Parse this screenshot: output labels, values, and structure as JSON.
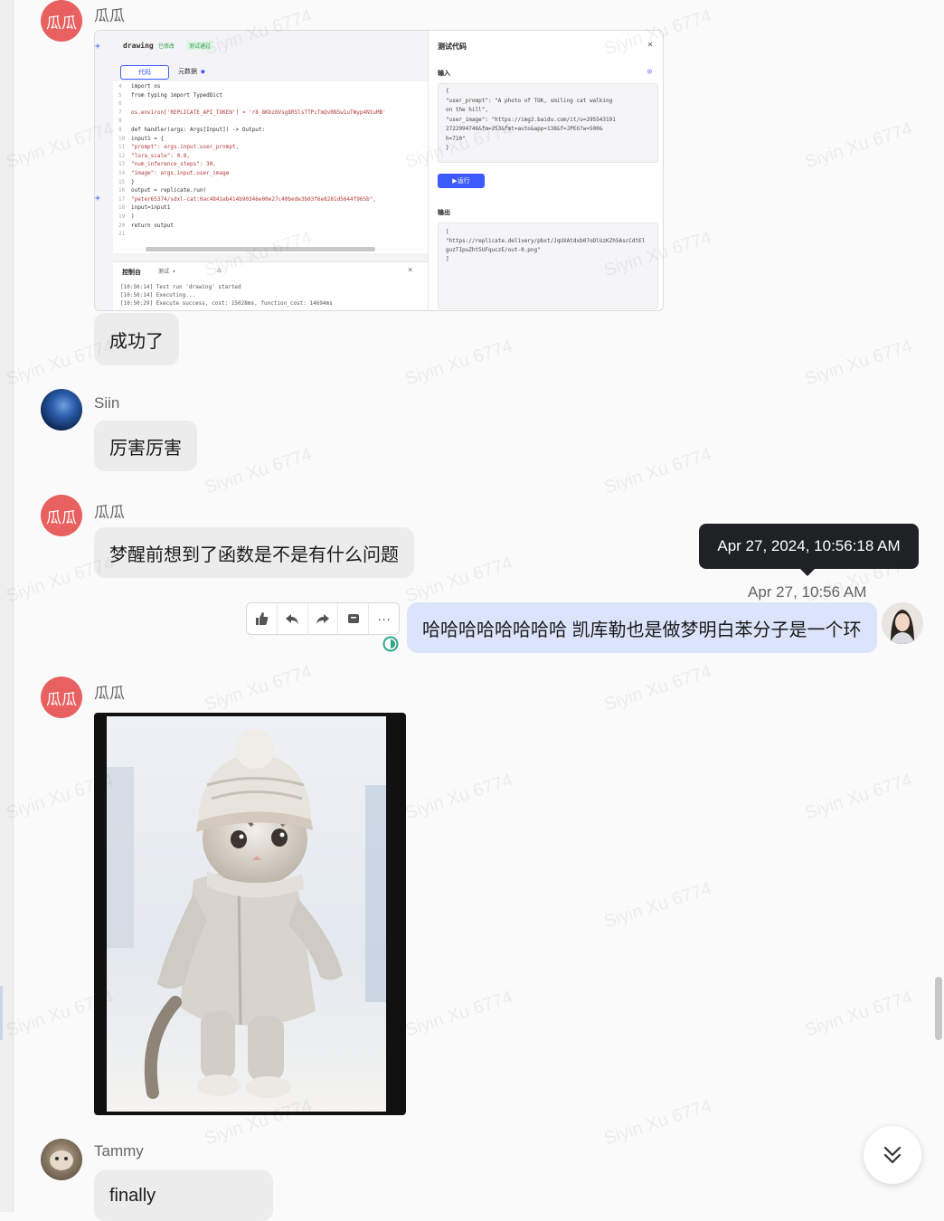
{
  "messages": {
    "m1": {
      "sender": "瓜瓜",
      "avatar_text": "瓜瓜",
      "text": "成功了"
    },
    "m2": {
      "sender": "Siin",
      "text": "厉害厉害"
    },
    "m3": {
      "sender": "瓜瓜",
      "avatar_text": "瓜瓜",
      "text": "梦醒前想到了函数是不是有什么问题"
    },
    "m4": {
      "time": "Apr 27, 10:56 AM",
      "tooltip": "Apr 27, 2024, 10:56:18 AM",
      "text": "哈哈哈哈哈哈哈哈 凯库勒也是做梦明白苯分子是一个环"
    },
    "m5": {
      "sender": "瓜瓜",
      "avatar_text": "瓜瓜"
    },
    "m6": {
      "sender": "Tammy",
      "text": "finally"
    }
  },
  "toolbar": {
    "icons": [
      "thumbs-up-icon",
      "reply-icon",
      "forward-icon",
      "save-icon",
      "more-icon"
    ],
    "more_label": "···"
  },
  "embedded_screenshot": {
    "app_name": "drawing",
    "status": "已修改",
    "badge": "测试通过",
    "tab_code": "代码",
    "tab_meta": "元数据",
    "console_title": "控制台",
    "console_select": "测试",
    "panel_title": "测试代码",
    "input_label": "输入",
    "run_button": "运行",
    "output_label": "输出",
    "code": [
      "import os",
      "from typing import TypedDict",
      "",
      "os.environ['REPLICATE_API_TOKEN'] = 'r8_8Kbz6Vsg8R5lsTTPcTmQvRN5w1uTWyp4NtuMB'",
      "",
      "def handler(args: Args[Input]) -> Output:",
      "    input1 = {",
      "        \"prompt\": args.input.user_prompt,",
      "        \"lora_scale\": 0.8,",
      "        \"num_inference_steps\": 30,",
      "        \"image\": args.input.user_image",
      "    }",
      "    output = replicate.run(",
      "        \"peter65374/sdxl-cat:0ac4841eb414b90346e00e27c40bede3b03f6e8281d5644f965b\",",
      "        input=input1",
      "    )",
      "    return output",
      ""
    ],
    "console_lines": [
      "[10:50:14] Test run 'drawing' started",
      "[10:50:14] Executing...",
      "[10:50:29] Execute success, cost: 15028ms, function_cost: 14694ms"
    ],
    "input_json": [
      "{",
      "  \"user_prompt\": \"A photo of TOK, smiling cat walking",
      "  on the hill\",",
      "  \"user_image\": \"https://img2.baidu.com/it/u=295543191",
      "  2722994746&fm=253&fmt=auto&app=138&f=JPEG?w=500&",
      "  h=710\"",
      "}"
    ],
    "output_json": [
      "[",
      "  \"https://replicate.delivery/pbxt/JqUXAtdxb07oDlUzKZh5AscCdtEl",
      "  guzTIpuZht5UFquczE/out-0.png\"",
      "]"
    ]
  },
  "watermark_text": "Siyin Xu 6774",
  "colors": {
    "avatar_red": "#e86060",
    "my_bubble": "#dbe4fb",
    "other_bubble": "#ececec",
    "run_button": "#3d5afe"
  }
}
